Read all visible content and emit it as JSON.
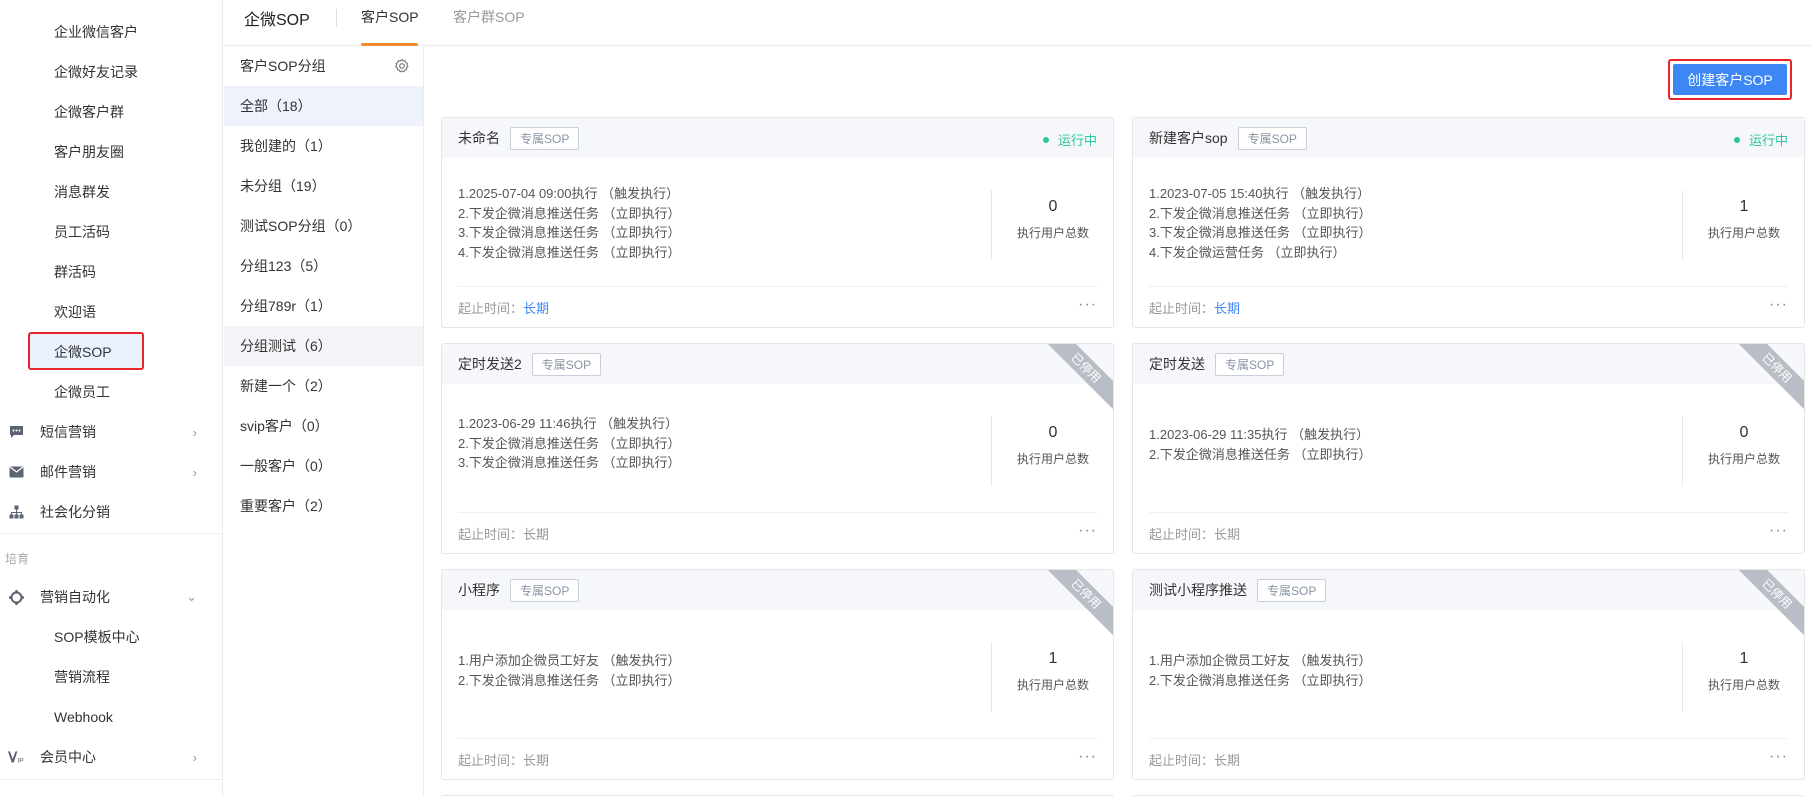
{
  "nav": {
    "items": [
      {
        "label": "企业微信客户",
        "type": "sub"
      },
      {
        "label": "企微好友记录",
        "type": "sub"
      },
      {
        "label": "企微客户群",
        "type": "sub"
      },
      {
        "label": "客户朋友圈",
        "type": "sub"
      },
      {
        "label": "消息群发",
        "type": "sub"
      },
      {
        "label": "员工活码",
        "type": "sub"
      },
      {
        "label": "群活码",
        "type": "sub"
      },
      {
        "label": "欢迎语",
        "type": "sub"
      },
      {
        "label": "企微SOP",
        "type": "sub",
        "active": true
      },
      {
        "label": "企微员工",
        "type": "sub"
      },
      {
        "label": "短信营销",
        "type": "top",
        "icon": "chat-icon",
        "arrow": "›"
      },
      {
        "label": "邮件营销",
        "type": "top",
        "icon": "mail-icon",
        "arrow": "›"
      },
      {
        "label": "社会化分销",
        "type": "top",
        "icon": "org-chart-icon"
      },
      {
        "label": "营销自动化",
        "type": "top",
        "icon": "gear-circle-icon",
        "arrow": "⌄"
      },
      {
        "label": "SOP模板中心",
        "type": "sub"
      },
      {
        "label": "营销流程",
        "type": "sub"
      },
      {
        "label": "Webhook",
        "type": "sub"
      },
      {
        "label": "会员中心",
        "type": "top",
        "icon": "vip-icon",
        "arrow": "›"
      }
    ],
    "group_label": "培育"
  },
  "topbar": {
    "title": "企微SOP",
    "tabs": [
      "客户SOP",
      "客户群SOP"
    ]
  },
  "groups": {
    "header": "客户SOP分组",
    "items": [
      "全部（18）",
      "我创建的（1）",
      "未分组（19）",
      "测试SOP分组（0）",
      "分组123（5）",
      "分组789r（1）",
      "分组测试（6）",
      "新建一个（2）",
      "svip客户（0）",
      "一般客户（0）",
      "重要客户（2）"
    ]
  },
  "main": {
    "create_button": "创建客户SOP",
    "stat_label": "执行用户总数",
    "period_label": "起止时间：",
    "cards": [
      {
        "name": "未命名",
        "tag": "专属SOP",
        "status": "运行中",
        "steps": [
          "1.2025-07-04 09:00执行 （触发执行）",
          "2.下发企微消息推送任务 （立即执行）",
          "3.下发企微消息推送任务 （立即执行）",
          "4.下发企微消息推送任务 （立即执行）"
        ],
        "count": "0",
        "period": "长期"
      },
      {
        "name": "新建客户sop",
        "tag": "专属SOP",
        "status": "运行中",
        "steps": [
          "1.2023-07-05 15:40执行 （触发执行）",
          "2.下发企微消息推送任务 （立即执行）",
          "3.下发企微消息推送任务 （立即执行）",
          "4.下发企微运营任务 （立即执行）"
        ],
        "count": "1",
        "period": "长期"
      },
      {
        "name": "定时发送2",
        "tag": "专属SOP",
        "ribbon": "已停用",
        "steps": [
          "1.2023-06-29 11:46执行 （触发执行）",
          "2.下发企微消息推送任务 （立即执行）",
          "3.下发企微消息推送任务 （立即执行）"
        ],
        "count": "0",
        "period": "长期"
      },
      {
        "name": "定时发送",
        "tag": "专属SOP",
        "ribbon": "已停用",
        "steps": [
          "1.2023-06-29 11:35执行 （触发执行）",
          "2.下发企微消息推送任务 （立即执行）"
        ],
        "count": "0",
        "period": "长期"
      },
      {
        "name": "小程序",
        "tag": "专属SOP",
        "ribbon": "已停用",
        "steps": [
          "1.用户添加企微员工好友 （触发执行）",
          "2.下发企微消息推送任务 （立即执行）"
        ],
        "count": "1",
        "period": "长期"
      },
      {
        "name": "测试小程序推送",
        "tag": "专属SOP",
        "ribbon": "已停用",
        "steps": [
          "1.用户添加企微员工好友 （触发执行）",
          "2.下发企微消息推送任务 （立即执行）"
        ],
        "count": "1",
        "period": "长期"
      }
    ]
  }
}
